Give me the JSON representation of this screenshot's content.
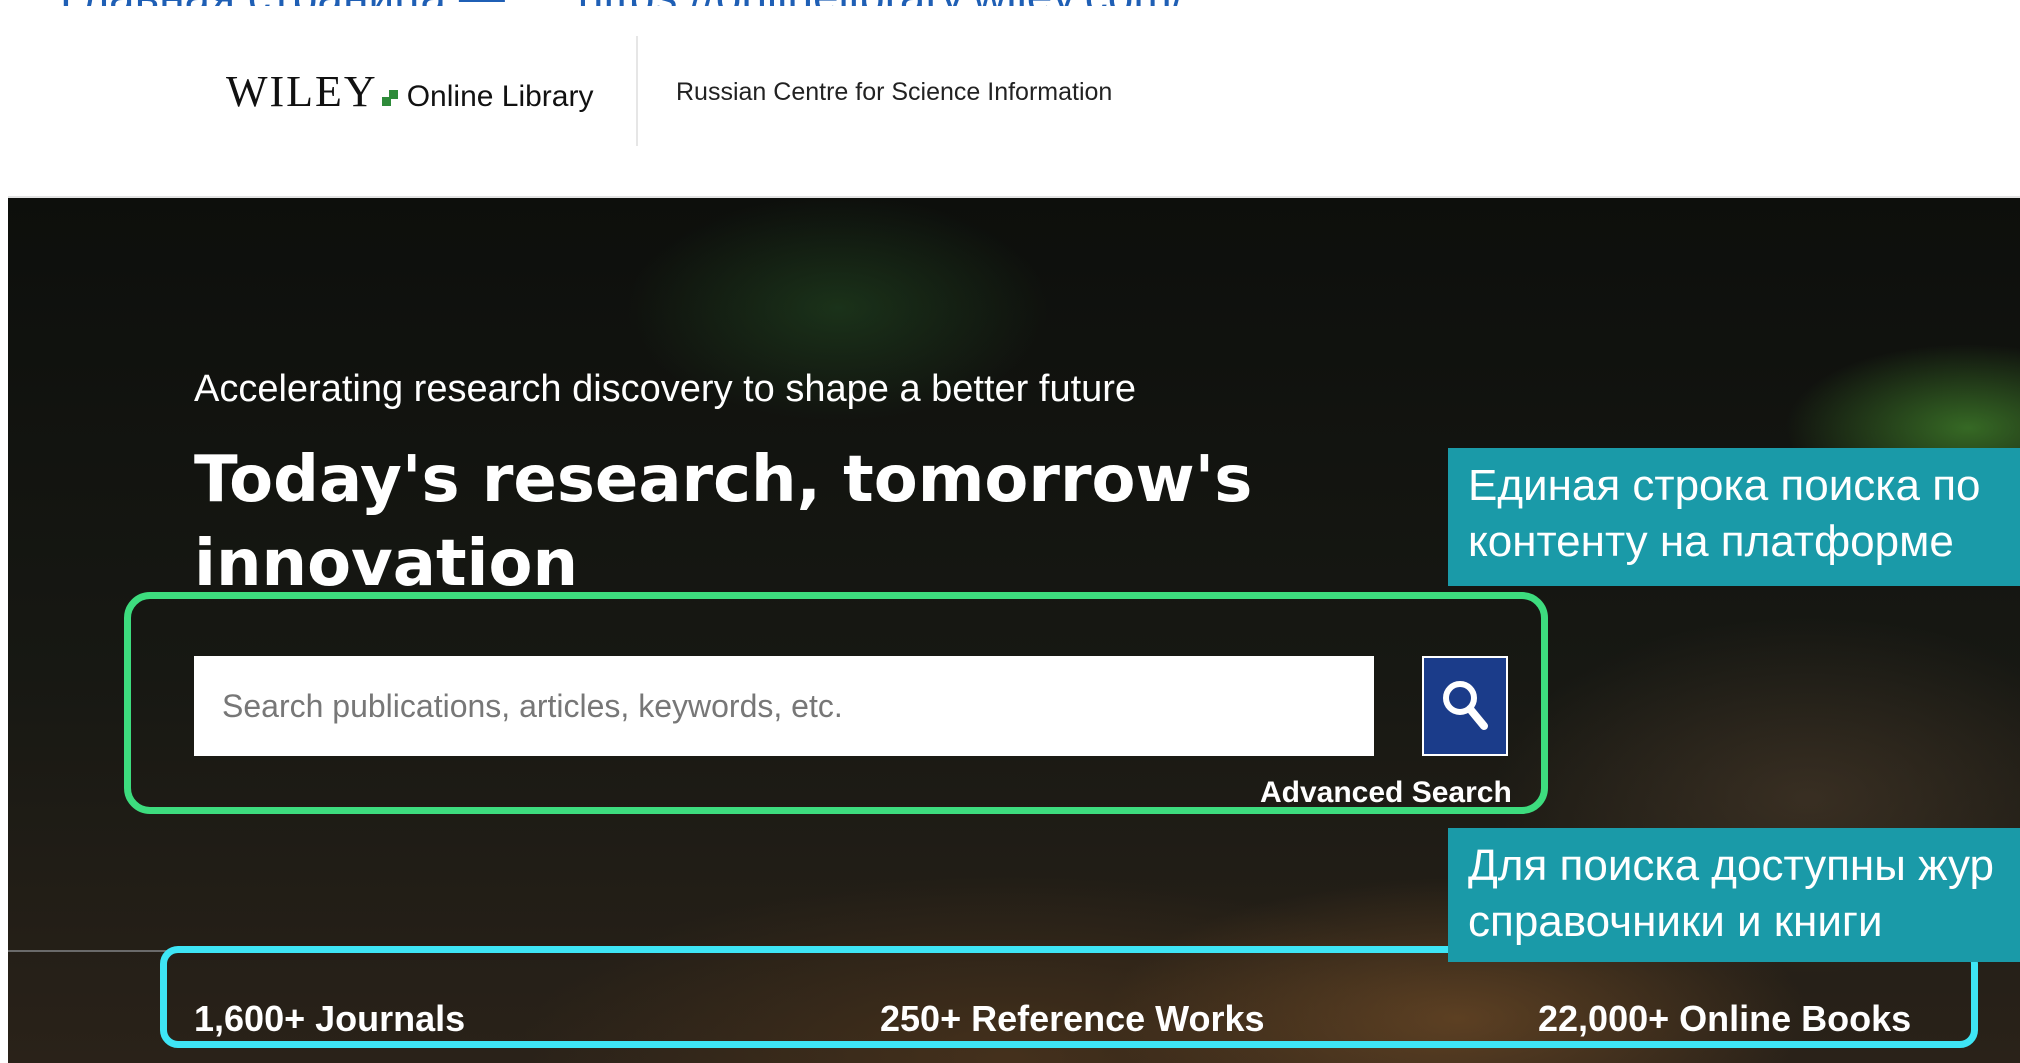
{
  "slide": {
    "title": "Главная страница",
    "url": "https://onlinelibrary.wiley.com/"
  },
  "header": {
    "logo_brand": "WILEY",
    "logo_product": "Online Library",
    "institution": "Russian Centre for Science Information"
  },
  "hero": {
    "tagline": "Accelerating research discovery to shape a better future",
    "headline": "Today's research, tomorrow's innovation"
  },
  "search": {
    "placeholder": "Search publications, articles, keywords, etc.",
    "value": "",
    "button_icon": "search-icon",
    "advanced_label": "Advanced Search"
  },
  "stats": [
    {
      "label": "1,600+ Journals"
    },
    {
      "label": "250+ Reference Works"
    },
    {
      "label": "22,000+ Online Books"
    }
  ],
  "callouts": [
    {
      "line1": "Единая строка поиска по",
      "line2": "контенту на платформе"
    },
    {
      "line1": "Для поиска доступны жур",
      "line2": "справочники и  книги"
    }
  ],
  "colors": {
    "title_blue": "#1f5fb5",
    "search_button": "#1b3c8a",
    "highlight_green": "#3ddc7e",
    "highlight_cyan": "#3ee5f5",
    "callout_teal": "#1a9aa8",
    "logo_green": "#2e8b3a"
  }
}
